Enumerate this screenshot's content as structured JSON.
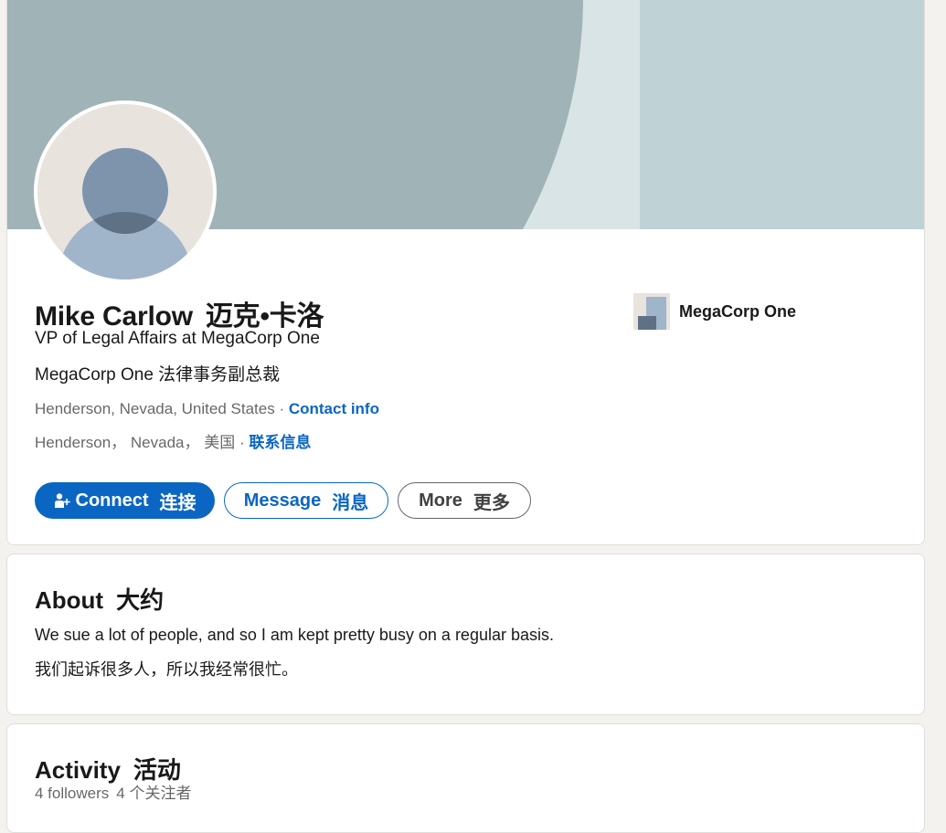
{
  "colors": {
    "brand_blue": "#0a66c2",
    "banner_dark": "#a0b3b7",
    "banner_light": "#d9e4e6",
    "banner_right": "#bfd3d7",
    "page_bg": "#f4f2ee"
  },
  "profile": {
    "name": "Mike Carlow",
    "name_zh": "迈克•卡洛",
    "headline": "VP of Legal Affairs at MegaCorp One",
    "headline_zh": "MegaCorp One 法律事务副总裁",
    "location": "Henderson, Nevada, United States",
    "location_zh": "Henderson， Nevada， 美国",
    "location_separator": " · ",
    "contact_info_label": "Contact info",
    "contact_info_label_zh": "联系信息",
    "company": "MegaCorp One"
  },
  "actions": {
    "connect_label": "Connect",
    "connect_label_zh": "连接",
    "message_label": "Message",
    "message_label_zh": "消息",
    "more_label": "More",
    "more_label_zh": "更多",
    "connect_icon": "add-person-icon"
  },
  "about": {
    "title": "About",
    "title_zh": "大约",
    "text": "We sue a lot of people, and so I am kept pretty busy on a regular basis.",
    "text_zh": "我们起诉很多人，所以我经常很忙。"
  },
  "activity": {
    "title": "Activity",
    "title_zh": "活动",
    "followers": "4 followers",
    "followers_zh": "4 个关注者"
  }
}
